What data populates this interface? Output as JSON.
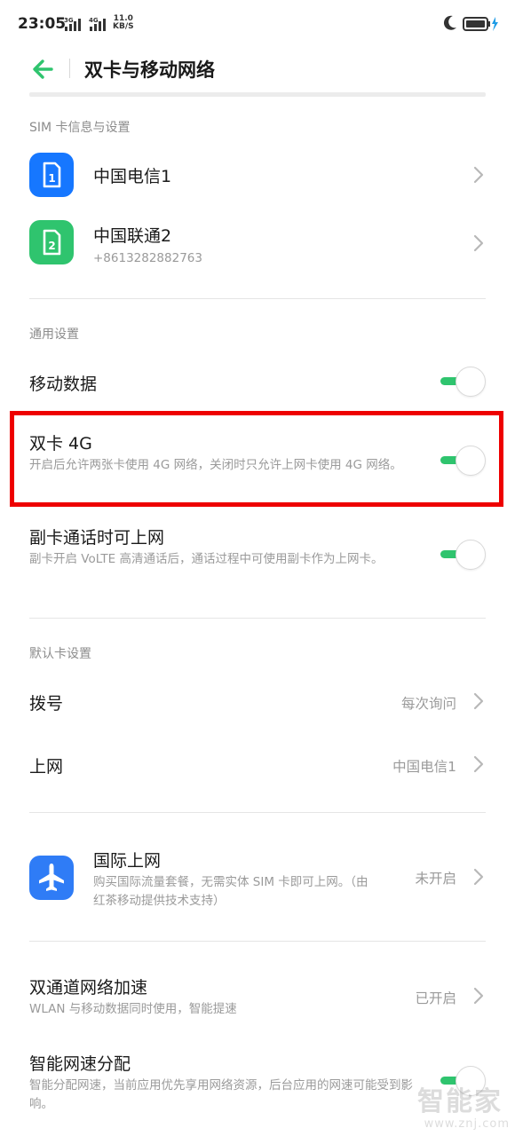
{
  "status_bar": {
    "time": "23:05",
    "net_speed_value": "11.0",
    "net_speed_unit": "KB/S",
    "signal_labels": [
      "3G",
      "4G"
    ]
  },
  "header": {
    "title": "双卡与移动网络"
  },
  "sim_section": {
    "label": "SIM 卡信息与设置",
    "cards": [
      {
        "name": "中国电信1",
        "number": "",
        "slot": "1",
        "icon": "sim-card-icon"
      },
      {
        "name": "中国联通2",
        "number": "+8613282882763",
        "slot": "2",
        "icon": "sim-card-icon"
      }
    ]
  },
  "general_section": {
    "label": "通用设置",
    "mobile_data": {
      "title": "移动数据",
      "enabled": true
    },
    "dual_4g": {
      "title": "双卡 4G",
      "desc": "开启后允许两张卡使用 4G 网络，关闭时只允许上网卡使用 4G 网络。",
      "enabled": true
    },
    "secondary_data": {
      "title": "副卡通话时可上网",
      "desc": "副卡开启 VoLTE 高清通话后，通话过程中可使用副卡作为上网卡。",
      "enabled": true
    }
  },
  "default_section": {
    "label": "默认卡设置",
    "dial": {
      "title": "拨号",
      "value": "每次询问"
    },
    "internet": {
      "title": "上网",
      "value": "中国电信1"
    }
  },
  "roaming": {
    "title": "国际上网",
    "desc": "购买国际流量套餐，无需实体 SIM 卡即可上网。（由红茶移动提供技术支持）",
    "value": "未开启",
    "icon": "airplane-icon"
  },
  "acceleration": {
    "title": "双通道网络加速",
    "desc": "WLAN 与移动数据同时使用，智能提速",
    "value": "已开启"
  },
  "smart_speed": {
    "title": "智能网速分配",
    "desc": "智能分配网速，当前应用优先享用网络资源，后台应用的网速可能受到影响。",
    "enabled": true
  },
  "watermark": {
    "text": "智能家",
    "url": "www.znj.com"
  },
  "colors": {
    "accent_green": "#2fc46e",
    "sim1_blue": "#1677ff",
    "highlight_red": "#ee0000"
  }
}
